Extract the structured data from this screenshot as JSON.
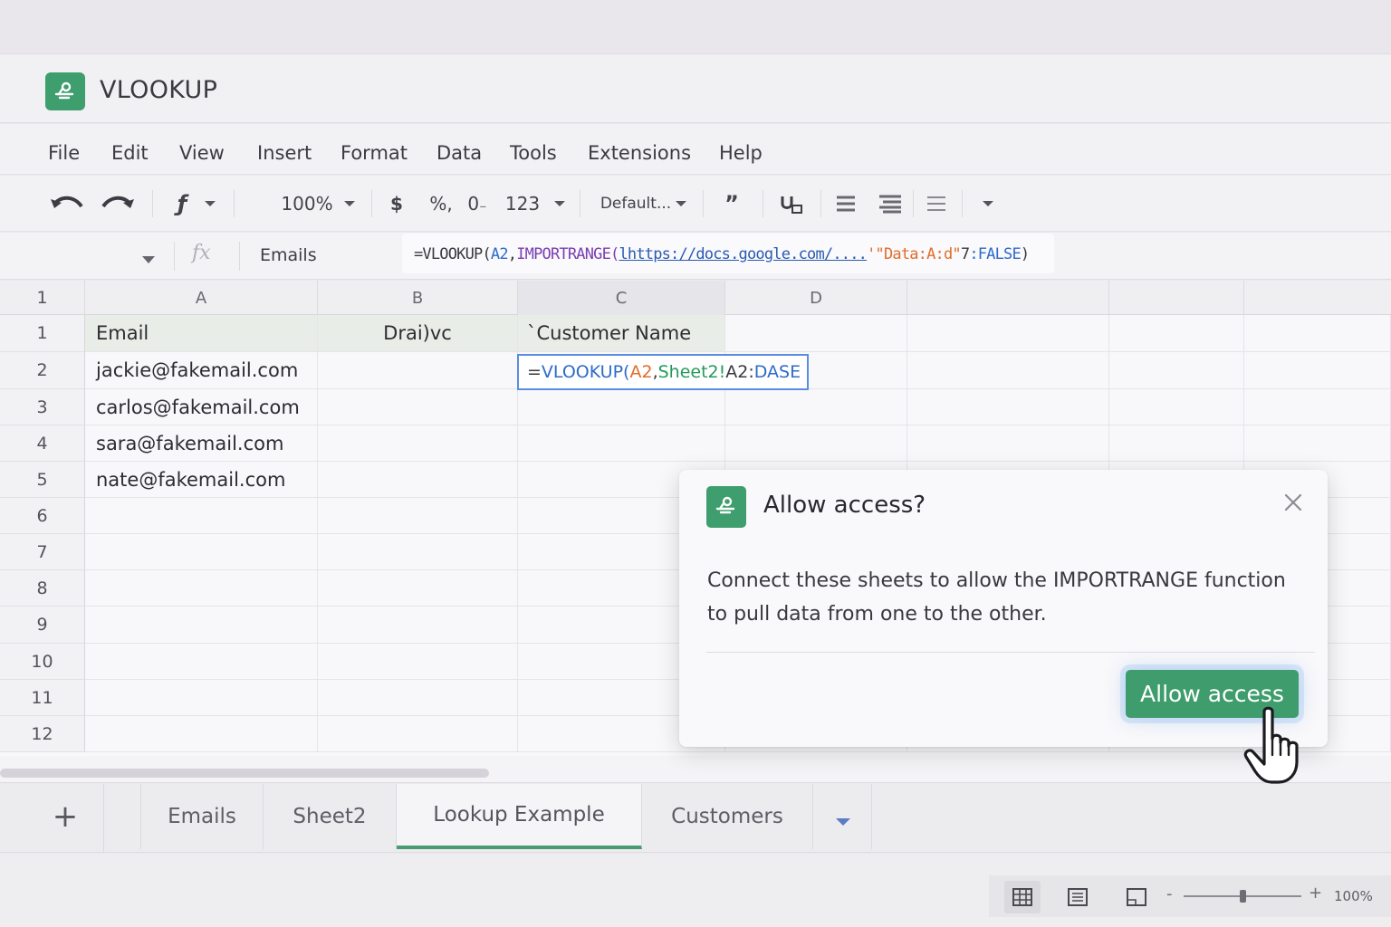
{
  "app": {
    "title": "VLOOKUP",
    "accent_color": "#3e9e6e"
  },
  "menu": {
    "items": [
      "File",
      "Edit",
      "View",
      "Insert",
      "Format",
      "Data",
      "Tools",
      "Extensions",
      "Help"
    ]
  },
  "toolbar": {
    "zoom": "100%",
    "currency": "$",
    "percent": "%,",
    "decimal": "0",
    "number_format": "123",
    "font": "Default..."
  },
  "formula_bar": {
    "cell_ref_placeholder": "",
    "fx_label": "fx",
    "active_value": "Emails",
    "formula_parts": [
      {
        "text": "=VLOOKUP(",
        "style": "black"
      },
      {
        "text": "A2",
        "style": "blue"
      },
      {
        "text": ",",
        "style": "black"
      },
      {
        "text": "IMPORTRANGE(",
        "style": "purple"
      },
      {
        "text": "lhttps://docs.google.com/....",
        "style": "link"
      },
      {
        "text": "'\"Data:A:d\"",
        "style": "orange"
      },
      {
        "text": "7",
        "style": "black"
      },
      {
        "text": ":FALSE",
        "style": "blue"
      },
      {
        "text": ")",
        "style": "black"
      }
    ]
  },
  "grid": {
    "corner_label": "1",
    "columns": [
      "A",
      "B",
      "C",
      "D"
    ],
    "rows": [
      {
        "num": "1",
        "cells": [
          "Email",
          "Drai)vc",
          "`Customer Name",
          ""
        ]
      },
      {
        "num": "2",
        "cells": [
          "jackie@fakemail.com",
          "",
          "",
          ""
        ]
      },
      {
        "num": "3",
        "cells": [
          "carlos@fakemail.com",
          "",
          "",
          ""
        ]
      },
      {
        "num": "4",
        "cells": [
          "sara@fakemail.com",
          "",
          "",
          ""
        ]
      },
      {
        "num": "5",
        "cells": [
          "nate@fakemail.com",
          "",
          "",
          ""
        ]
      },
      {
        "num": "6",
        "cells": [
          "",
          "",
          "",
          ""
        ]
      },
      {
        "num": "7",
        "cells": [
          "",
          "",
          "",
          ""
        ]
      },
      {
        "num": "8",
        "cells": [
          "",
          "",
          "",
          ""
        ]
      },
      {
        "num": "9",
        "cells": [
          "",
          "",
          "",
          ""
        ]
      },
      {
        "num": "10",
        "cells": [
          "",
          "",
          "",
          ""
        ]
      },
      {
        "num": "11",
        "cells": [
          "",
          "",
          "",
          ""
        ]
      },
      {
        "num": "12",
        "cells": [
          "",
          "",
          "",
          ""
        ]
      }
    ],
    "editing_cell_parts": [
      {
        "text": "=",
        "style": "black"
      },
      {
        "text": "VLOOKUP(",
        "style": "blue"
      },
      {
        "text": "A2",
        "style": "orange"
      },
      {
        "text": ",",
        "style": "black"
      },
      {
        "text": "Sheet2!",
        "style": "green"
      },
      {
        "text": "A2:",
        "style": "black"
      },
      {
        "text": "DASE",
        "style": "blue"
      }
    ]
  },
  "sheets": {
    "add_label": "+",
    "tabs": [
      "Emails",
      "Sheet2",
      "Lookup Example",
      "Customers"
    ],
    "active": "Lookup Example"
  },
  "status": {
    "zoom_minus": "-",
    "zoom_plus": "+",
    "zoom_pct": "100%",
    "zoom_level": 0.5
  },
  "dialog": {
    "title": "Allow access?",
    "body": "Connect these sheets to allow the IMPORTRANGE function to pull data from one to the other.",
    "button": "Allow access",
    "button_color": "#3f9c6c"
  }
}
